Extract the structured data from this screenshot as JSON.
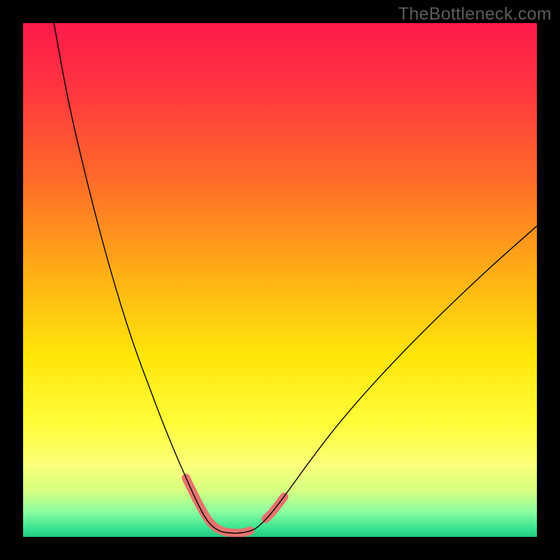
{
  "watermark": "TheBottleneck.com",
  "chart_data": {
    "type": "line",
    "title": "",
    "xlabel": "",
    "ylabel": "",
    "xlim": [
      0,
      100
    ],
    "ylim": [
      0,
      100
    ],
    "background_gradient": {
      "stops": [
        {
          "offset": 0.0,
          "color": "#ff1a4b"
        },
        {
          "offset": 0.12,
          "color": "#ff3340"
        },
        {
          "offset": 0.3,
          "color": "#ff6a2a"
        },
        {
          "offset": 0.5,
          "color": "#ffb314"
        },
        {
          "offset": 0.65,
          "color": "#ffe60a"
        },
        {
          "offset": 0.78,
          "color": "#fffd3a"
        },
        {
          "offset": 0.86,
          "color": "#fbff7a"
        },
        {
          "offset": 0.91,
          "color": "#d6ff80"
        },
        {
          "offset": 0.95,
          "color": "#8dffa0"
        },
        {
          "offset": 0.985,
          "color": "#35e28e"
        },
        {
          "offset": 1.0,
          "color": "#25c87e"
        }
      ]
    },
    "series": [
      {
        "name": "bottleneck-curve",
        "color": "#000000",
        "width": 1.4,
        "points": [
          {
            "x": 6.0,
            "y": 100.0
          },
          {
            "x": 9.0,
            "y": 84.0
          },
          {
            "x": 13.0,
            "y": 67.0
          },
          {
            "x": 17.0,
            "y": 52.0
          },
          {
            "x": 21.0,
            "y": 39.0
          },
          {
            "x": 25.0,
            "y": 28.0
          },
          {
            "x": 28.5,
            "y": 19.0
          },
          {
            "x": 31.5,
            "y": 12.0
          },
          {
            "x": 34.0,
            "y": 6.5
          },
          {
            "x": 36.0,
            "y": 3.0
          },
          {
            "x": 38.0,
            "y": 1.3
          },
          {
            "x": 40.0,
            "y": 0.8
          },
          {
            "x": 42.5,
            "y": 0.8
          },
          {
            "x": 45.0,
            "y": 1.5
          },
          {
            "x": 47.0,
            "y": 3.2
          },
          {
            "x": 49.0,
            "y": 5.5
          },
          {
            "x": 52.0,
            "y": 9.5
          },
          {
            "x": 56.0,
            "y": 15.0
          },
          {
            "x": 61.0,
            "y": 21.5
          },
          {
            "x": 67.0,
            "y": 28.5
          },
          {
            "x": 74.0,
            "y": 36.0
          },
          {
            "x": 82.0,
            "y": 44.0
          },
          {
            "x": 91.0,
            "y": 52.5
          },
          {
            "x": 100.0,
            "y": 60.5
          }
        ]
      },
      {
        "name": "highlight-left",
        "color": "#e6736e",
        "width": 12,
        "cap": "round",
        "points": [
          {
            "x": 31.7,
            "y": 11.5
          },
          {
            "x": 33.2,
            "y": 8.4
          },
          {
            "x": 34.6,
            "y": 5.7
          },
          {
            "x": 36.0,
            "y": 3.4
          },
          {
            "x": 37.4,
            "y": 1.9
          },
          {
            "x": 39.0,
            "y": 1.1
          },
          {
            "x": 40.8,
            "y": 0.8
          },
          {
            "x": 42.6,
            "y": 0.8
          },
          {
            "x": 44.2,
            "y": 1.2
          }
        ]
      },
      {
        "name": "highlight-right",
        "color": "#e6736e",
        "width": 12,
        "cap": "round",
        "points": [
          {
            "x": 47.2,
            "y": 3.5
          },
          {
            "x": 48.4,
            "y": 4.7
          },
          {
            "x": 49.6,
            "y": 6.2
          },
          {
            "x": 50.8,
            "y": 7.8
          }
        ]
      }
    ]
  }
}
